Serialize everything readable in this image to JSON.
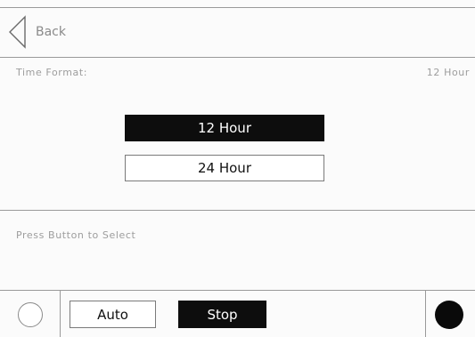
{
  "header": {
    "back_label": "Back"
  },
  "setting": {
    "label": "Time Format:",
    "current_value": "12 Hour",
    "options": [
      {
        "label": "12 Hour",
        "selected": true
      },
      {
        "label": "24 Hour",
        "selected": false
      }
    ]
  },
  "hint": {
    "text": "Press Button to Select"
  },
  "bottom_bar": {
    "auto_label": "Auto",
    "stop_label": "Stop"
  },
  "icons": {
    "back": "back-arrow-icon",
    "status": "status-circle-icon",
    "record": "record-dot-icon"
  },
  "colors": {
    "selected_bg": "#0d0d0d",
    "selected_text": "#ffffff",
    "muted_text": "#9d9d9d",
    "divider": "#9a9a9a"
  }
}
